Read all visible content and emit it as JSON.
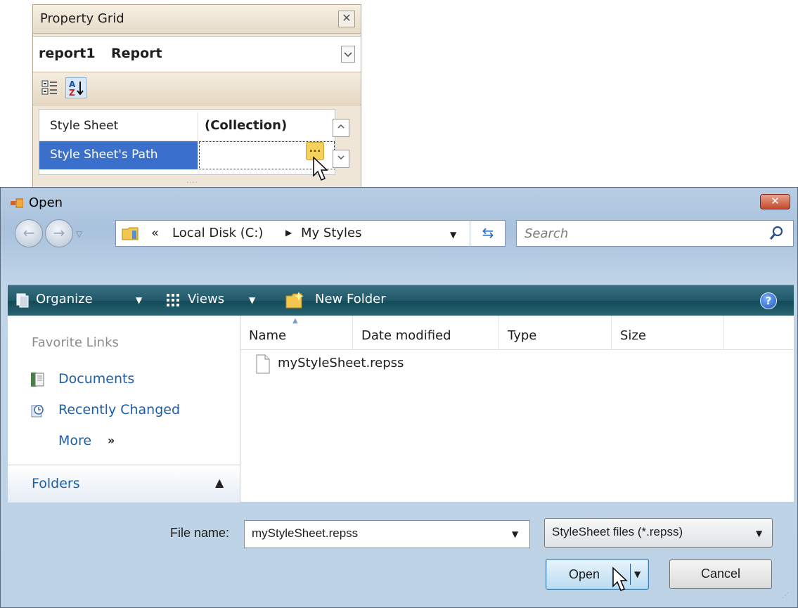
{
  "property_grid": {
    "title": "Property Grid",
    "object_name": "report1",
    "object_type": "Report",
    "rows": [
      {
        "name": "Style Sheet",
        "value": "(Collection)"
      },
      {
        "name": "Style Sheet's Path",
        "value": ""
      }
    ],
    "ellipsis_label": "...",
    "splitter_dots": "....",
    "icons": [
      "categorized-icon",
      "alphabetical-icon",
      "close-icon",
      "chevron-down-icon",
      "ellipsis-icon",
      "scroll-up-icon",
      "scroll-down-icon"
    ]
  },
  "dialog": {
    "title": "Open",
    "address": {
      "prefix": "«",
      "crumb1": "Local Disk (C:)",
      "crumb2": "My Styles"
    },
    "search": {
      "placeholder": "Search"
    },
    "toolbar": {
      "organize": "Organize",
      "views": "Views",
      "new_folder": "New Folder",
      "help": "?"
    },
    "nav": {
      "favorite_links": "Favorite Links",
      "documents": "Documents",
      "recently_changed": "Recently Changed",
      "more": "More",
      "more_chevron": "»",
      "folders": "Folders"
    },
    "columns": [
      "Name",
      "Date modified",
      "Type",
      "Size"
    ],
    "files": [
      {
        "name": "myStyleSheet.repss"
      }
    ],
    "file_name_label": "File name:",
    "file_name_value": "myStyleSheet.repss",
    "file_type_value": "StyleSheet files (*.repss)",
    "open_label": "Open",
    "cancel_label": "Cancel",
    "colors": {
      "accent": "#3b6fcc",
      "command_bar": "#1f5868",
      "link": "#1d5fa8",
      "close": "#c64a2d"
    }
  }
}
